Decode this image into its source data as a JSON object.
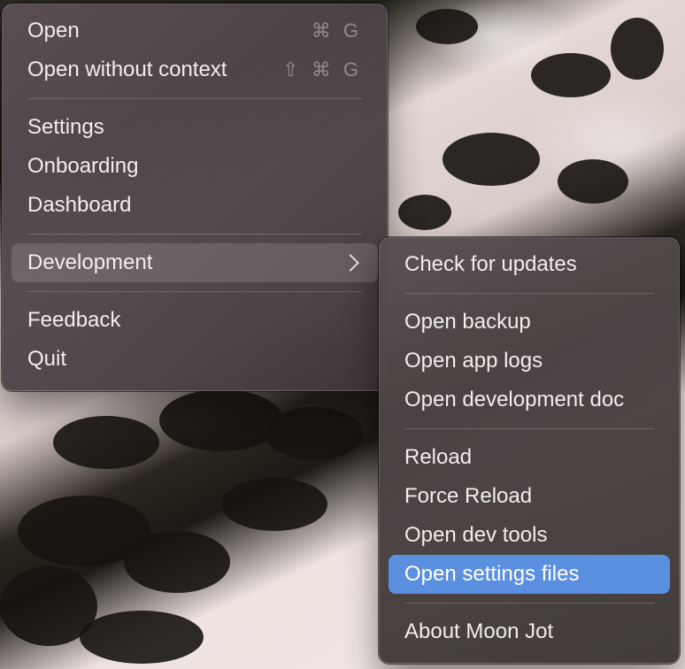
{
  "main_menu": {
    "groups": [
      [
        {
          "label": "Open",
          "shortcut": "⌘ G"
        },
        {
          "label": "Open without context",
          "shortcut": "⇧ ⌘ G"
        }
      ],
      [
        {
          "label": "Settings"
        },
        {
          "label": "Onboarding"
        },
        {
          "label": "Dashboard"
        }
      ],
      [
        {
          "label": "Development",
          "submenu": true,
          "state": "highlighted"
        }
      ],
      [
        {
          "label": "Feedback"
        },
        {
          "label": "Quit"
        }
      ]
    ]
  },
  "submenu": {
    "groups": [
      [
        {
          "label": "Check for updates"
        }
      ],
      [
        {
          "label": "Open backup"
        },
        {
          "label": "Open app logs"
        },
        {
          "label": "Open development doc"
        }
      ],
      [
        {
          "label": "Reload"
        },
        {
          "label": "Force Reload"
        },
        {
          "label": "Open dev tools"
        },
        {
          "label": "Open settings files",
          "state": "selected"
        }
      ],
      [
        {
          "label": "About Moon Jot"
        }
      ]
    ]
  },
  "colors": {
    "selection": "#5b8fe0",
    "menu_text": "#f2eeee",
    "shortcut_text": "rgba(255,255,255,0.38)"
  },
  "icons": {
    "submenu_indicator": "chevron-right-icon"
  }
}
